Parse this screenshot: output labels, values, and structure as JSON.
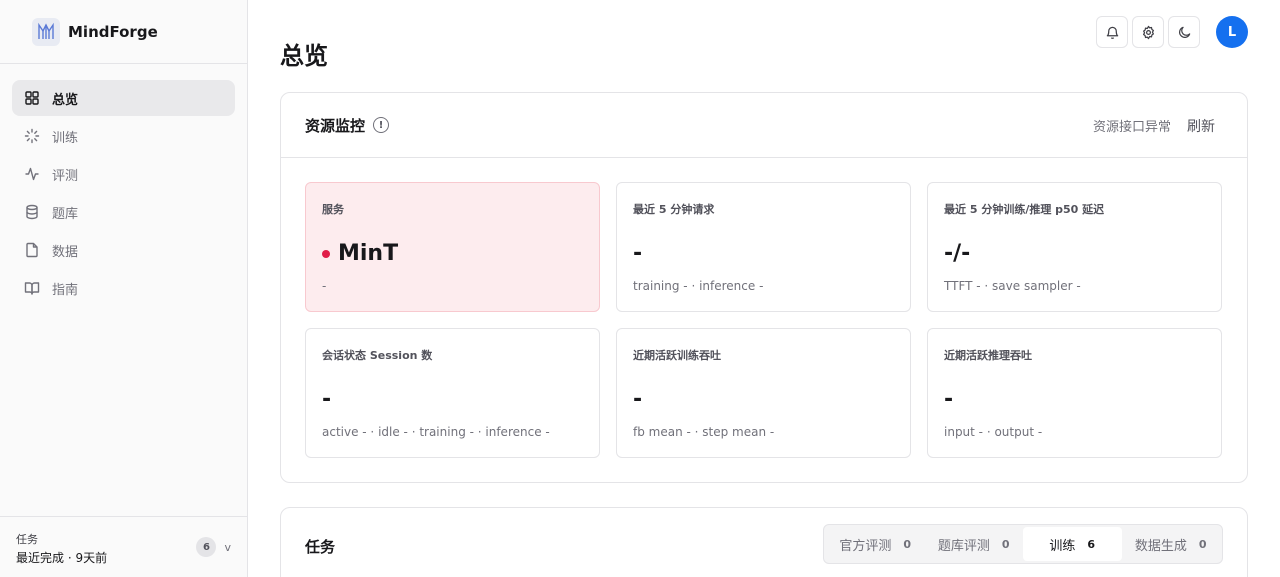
{
  "brand": {
    "name": "MindForge",
    "logo_icon": "mindforge-logo"
  },
  "sidebar": {
    "items": [
      {
        "label": "总览",
        "icon": "grid-icon",
        "active": true
      },
      {
        "label": "训练",
        "icon": "loader-icon",
        "active": false
      },
      {
        "label": "评测",
        "icon": "activity-icon",
        "active": false
      },
      {
        "label": "题库",
        "icon": "database-icon",
        "active": false
      },
      {
        "label": "数据",
        "icon": "file-icon",
        "active": false
      },
      {
        "label": "指南",
        "icon": "book-icon",
        "active": false
      }
    ],
    "footer": {
      "label": "任务",
      "status": "最近完成 · 9天前",
      "count": "6",
      "chevron": "v"
    }
  },
  "header": {
    "title": "总览",
    "actions": [
      "bell-icon",
      "gear-icon",
      "moon-icon"
    ],
    "avatar_initial": "L"
  },
  "resource": {
    "title": "资源监控",
    "info_glyph": "!",
    "api_status": "资源接口异常",
    "refresh_label": "刷新",
    "tiles": [
      {
        "label": "服务",
        "value": "MinT",
        "sub": "-",
        "alert": true
      },
      {
        "label": "最近 5 分钟请求",
        "value": "-",
        "sub": "training - · inference -",
        "alert": false
      },
      {
        "label": "最近 5 分钟训练/推理 p50 延迟",
        "value": "-/-",
        "sub": "TTFT - · save sampler -",
        "alert": false
      },
      {
        "label": "会话状态 Session 数",
        "value": "-",
        "sub": "active - · idle - · training - · inference -",
        "alert": false
      },
      {
        "label": "近期活跃训练吞吐",
        "value": "-",
        "sub": "fb mean - · step mean -",
        "alert": false
      },
      {
        "label": "近期活跃推理吞吐",
        "value": "-",
        "sub": "input - · output -",
        "alert": false
      }
    ]
  },
  "tasks": {
    "title": "任务",
    "tabs": [
      {
        "label": "官方评测",
        "count": "0",
        "active": false
      },
      {
        "label": "题库评测",
        "count": "0",
        "active": false
      },
      {
        "label": "训练",
        "count": "6",
        "active": true
      },
      {
        "label": "数据生成",
        "count": "0",
        "active": false
      }
    ]
  },
  "colors": {
    "accent": "#1570ef",
    "alert_dot": "#e11d48",
    "alert_bg": "#fdecee"
  }
}
